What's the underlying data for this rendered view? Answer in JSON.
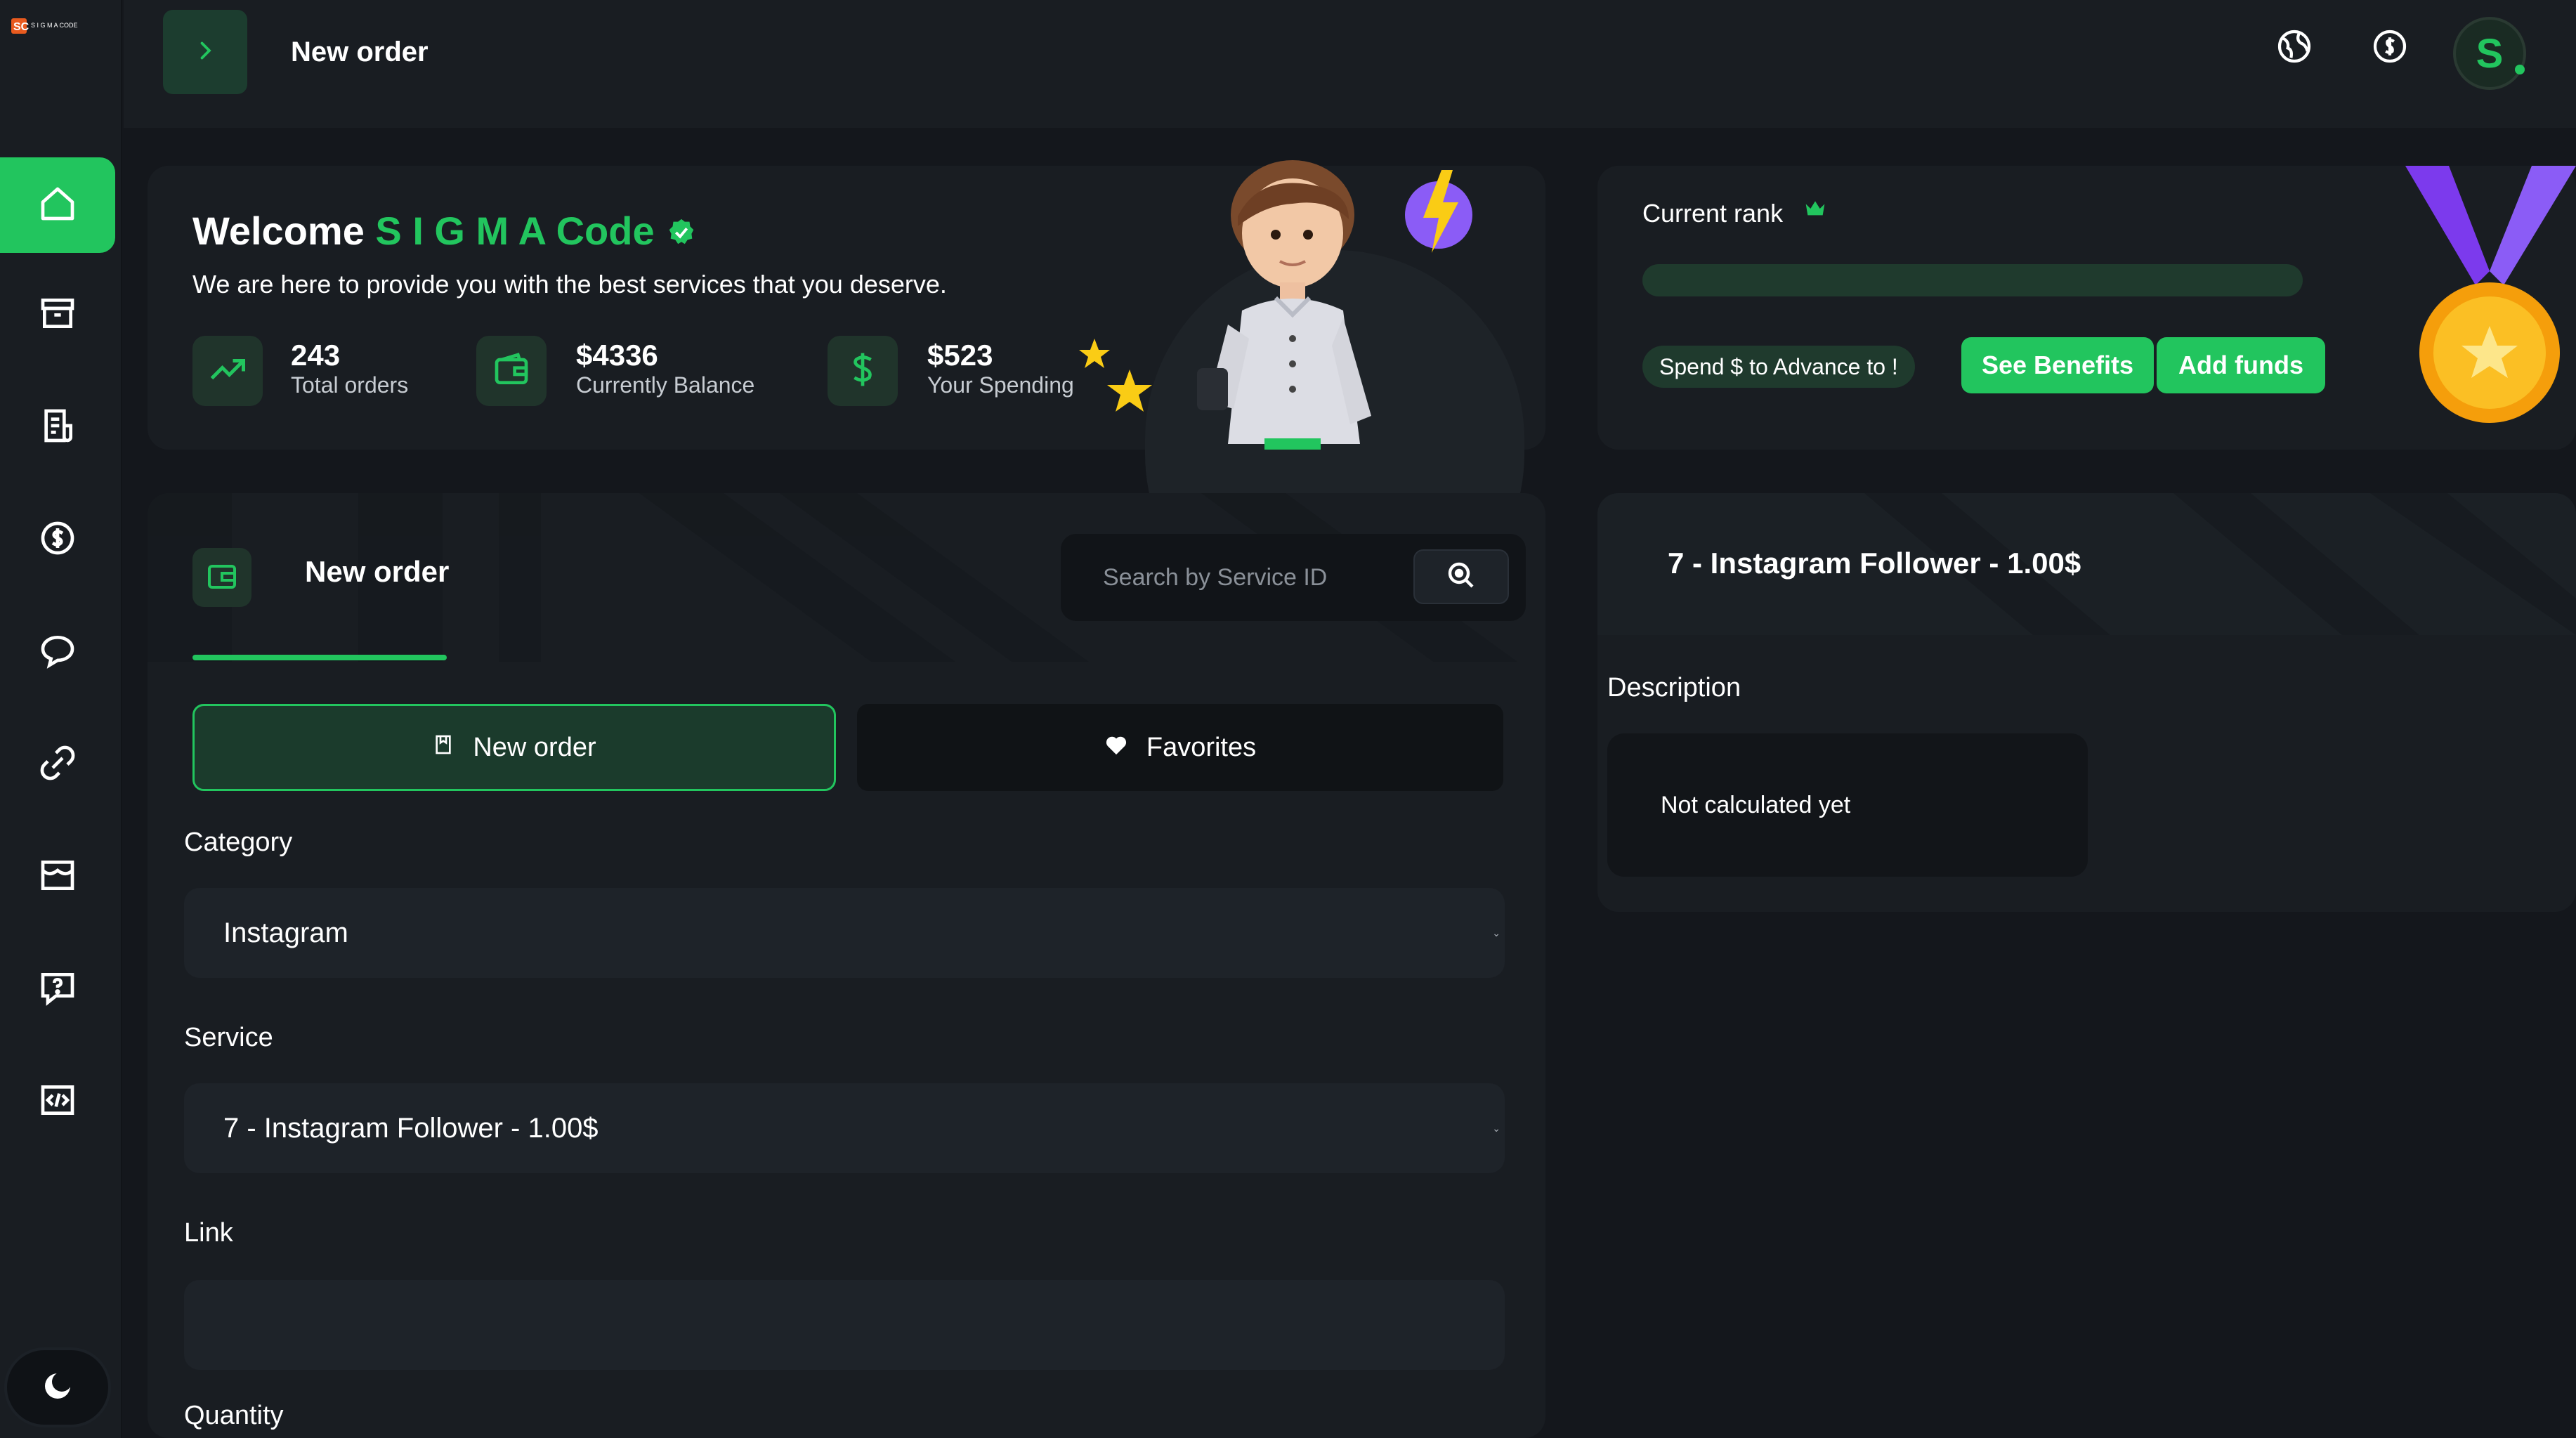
{
  "app": {
    "logo_text": "S I G M A CODE",
    "page_title": "New order"
  },
  "colors": {
    "accent": "#22c55e",
    "background": "#14171c",
    "card": "#191d22",
    "accent_dark": "#1c3d2f"
  },
  "sidebar": {
    "items": [
      {
        "name": "home",
        "icon": "home-icon",
        "active": true
      },
      {
        "name": "orders",
        "icon": "archive-icon",
        "active": false
      },
      {
        "name": "services",
        "icon": "receipt-icon",
        "active": false
      },
      {
        "name": "add-funds",
        "icon": "dollar-circle-icon",
        "active": false
      },
      {
        "name": "tickets",
        "icon": "chat-icon",
        "active": false
      },
      {
        "name": "affiliates",
        "icon": "link-icon",
        "active": false
      },
      {
        "name": "store",
        "icon": "store-icon",
        "active": false
      },
      {
        "name": "faq",
        "icon": "question-icon",
        "active": false
      },
      {
        "name": "api",
        "icon": "code-icon",
        "active": false
      }
    ],
    "theme_toggle_icon": "moon-icon"
  },
  "topbar": {
    "icons": [
      "globe-icon",
      "currency-icon"
    ],
    "avatar_letter": "S"
  },
  "welcome": {
    "title_prefix": "Welcome",
    "username": "S I G M A Code",
    "subtitle": "We are here to provide you with the best services that you deserve.",
    "stats": [
      {
        "value": "243",
        "label": "Total orders",
        "icon": "trend-up-icon"
      },
      {
        "value": "$4336",
        "label": "Currently Balance",
        "icon": "wallet-icon"
      },
      {
        "value": "$523",
        "label": "Your Spending",
        "icon": "dollar-icon"
      }
    ]
  },
  "rank": {
    "title": "Current rank",
    "progress": 0,
    "spend_text": "Spend $ to Advance to !",
    "benefits_label": "See Benefits",
    "add_funds_label": "Add funds"
  },
  "order": {
    "header_title": "New order",
    "search_placeholder": "Search by Service ID",
    "tabs": [
      {
        "label": "New order",
        "icon": "bookmark-icon",
        "active": true
      },
      {
        "label": "Favorites",
        "icon": "heart-icon",
        "active": false
      }
    ],
    "fields": {
      "category_label": "Category",
      "category_value": "Instagram",
      "service_label": "Service",
      "service_value": "7 - Instagram Follower - 1.00$",
      "link_label": "Link",
      "link_value": "",
      "quantity_label": "Quantity"
    }
  },
  "detail": {
    "title": "7 - Instagram Follower - 1.00$",
    "description_label": "Description",
    "description_value": "Not calculated yet"
  }
}
